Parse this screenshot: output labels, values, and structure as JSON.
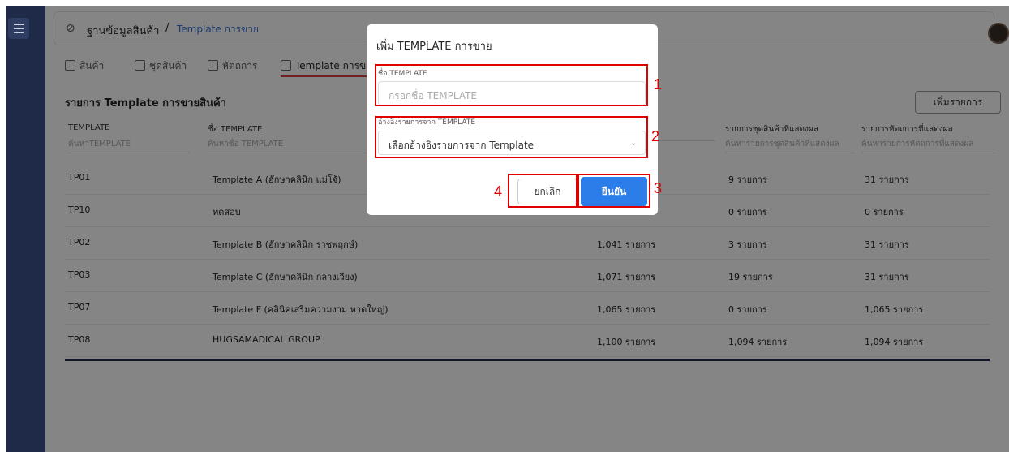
{
  "breadcrumb": {
    "root": "ฐานข้อมูลสินค้า",
    "separator": "/",
    "current": "Template การขาย"
  },
  "tabs": [
    {
      "label": "สินค้า"
    },
    {
      "label": "ชุดสินค้า"
    },
    {
      "label": "หัตถการ"
    },
    {
      "label": "Template การขาย"
    }
  ],
  "section": {
    "title": "รายการ Template การขายสินค้า",
    "add_button": "เพิ่มรายการ"
  },
  "table": {
    "headers": [
      "TEMPLATE",
      "ชื่อ TEMPLATE",
      "",
      "รายการชุดสินค้าที่แสดงผล",
      "รายการหัตถการที่แสดงผล"
    ],
    "filters": [
      "ค้นหาTEMPLATE",
      "ค้นหาชื่อ TEMPLATE",
      "",
      "ค้นหารายการชุดสินค้าที่แสดงผล",
      "ค้นหารายการหัตถการที่แสดงผล"
    ],
    "rows": [
      {
        "code": "TP01",
        "name": "Template A (ฮักษาคลินิก แม่โจ้)",
        "products": "",
        "sets": "9 รายการ",
        "procedures": "31 รายการ"
      },
      {
        "code": "TP10",
        "name": "ทดสอบ",
        "products": "",
        "sets": "0 รายการ",
        "procedures": "0 รายการ"
      },
      {
        "code": "TP02",
        "name": "Template B (ฮักษาคลินิก ราชพฤกษ์)",
        "products": "1,041 รายการ",
        "sets": "3 รายการ",
        "procedures": "31 รายการ"
      },
      {
        "code": "TP03",
        "name": "Template C (ฮักษาคลินิก กลางเวียง)",
        "products": "1,071 รายการ",
        "sets": "19 รายการ",
        "procedures": "31 รายการ"
      },
      {
        "code": "TP07",
        "name": "Template F (คลินิคเสริมความงาม หาดใหญ่)",
        "products": "1,065 รายการ",
        "sets": "0 รายการ",
        "procedures": "1,065 รายการ"
      },
      {
        "code": "TP08",
        "name": "HUGSAMADICAL GROUP",
        "products": "1,100 รายการ",
        "sets": "1,094 รายการ",
        "procedures": "1,094 รายการ"
      }
    ]
  },
  "modal": {
    "title": "เพิ่ม TEMPLATE การขาย",
    "name_label": "ชื่อ TEMPLATE",
    "name_placeholder": "กรอกชื่อ TEMPLATE",
    "ref_label": "อ้างอิงรายการจาก TEMPLATE",
    "ref_value": "เลือกอ้างอิงรายการจาก Template",
    "cancel": "ยกเลิก",
    "confirm": "ยืนยัน"
  },
  "annotations": [
    "1",
    "2",
    "3",
    "4"
  ],
  "colors": {
    "sidebar": "#1e2a47",
    "accent": "#2b7de9",
    "highlight": "#e00000"
  }
}
